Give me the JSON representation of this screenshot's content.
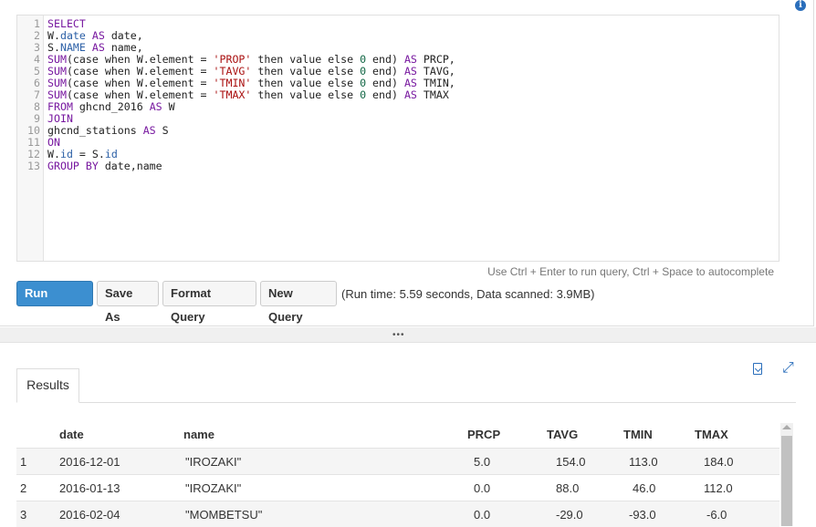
{
  "editor": {
    "lines": [
      [
        {
          "t": "SELECT",
          "c": "kw"
        }
      ],
      [
        {
          "t": "W."
        },
        {
          "t": "date",
          "c": "fld"
        },
        {
          "t": " "
        },
        {
          "t": "AS",
          "c": "kw"
        },
        {
          "t": " date,"
        }
      ],
      [
        {
          "t": "S."
        },
        {
          "t": "NAME",
          "c": "fld"
        },
        {
          "t": " "
        },
        {
          "t": "AS",
          "c": "kw"
        },
        {
          "t": " name,"
        }
      ],
      [
        {
          "t": "SUM",
          "c": "kw"
        },
        {
          "t": "(case when W.element = "
        },
        {
          "t": "'PROP'",
          "c": "str"
        },
        {
          "t": " then value else "
        },
        {
          "t": "0",
          "c": "num"
        },
        {
          "t": " end) "
        },
        {
          "t": "AS",
          "c": "kw"
        },
        {
          "t": " PRCP,"
        }
      ],
      [
        {
          "t": "SUM",
          "c": "kw"
        },
        {
          "t": "(case when W.element = "
        },
        {
          "t": "'TAVG'",
          "c": "str"
        },
        {
          "t": " then value else "
        },
        {
          "t": "0",
          "c": "num"
        },
        {
          "t": " end) "
        },
        {
          "t": "AS",
          "c": "kw"
        },
        {
          "t": " TAVG,"
        }
      ],
      [
        {
          "t": "SUM",
          "c": "kw"
        },
        {
          "t": "(case when W.element = "
        },
        {
          "t": "'TMIN'",
          "c": "str"
        },
        {
          "t": " then value else "
        },
        {
          "t": "0",
          "c": "num"
        },
        {
          "t": " end) "
        },
        {
          "t": "AS",
          "c": "kw"
        },
        {
          "t": " TMIN,"
        }
      ],
      [
        {
          "t": "SUM",
          "c": "kw"
        },
        {
          "t": "(case when W.element = "
        },
        {
          "t": "'TMAX'",
          "c": "str"
        },
        {
          "t": " then value else "
        },
        {
          "t": "0",
          "c": "num"
        },
        {
          "t": " end) "
        },
        {
          "t": "AS",
          "c": "kw"
        },
        {
          "t": " TMAX"
        }
      ],
      [
        {
          "t": "FROM",
          "c": "kw"
        },
        {
          "t": " ghcnd_2016 "
        },
        {
          "t": "AS",
          "c": "kw"
        },
        {
          "t": " W"
        }
      ],
      [
        {
          "t": "JOIN",
          "c": "kw"
        }
      ],
      [
        {
          "t": "ghcnd_stations "
        },
        {
          "t": "AS",
          "c": "kw"
        },
        {
          "t": " S"
        }
      ],
      [
        {
          "t": "ON",
          "c": "kw"
        }
      ],
      [
        {
          "t": "W."
        },
        {
          "t": "id",
          "c": "fld"
        },
        {
          "t": " = S."
        },
        {
          "t": "id",
          "c": "fld"
        }
      ],
      [
        {
          "t": "GROUP BY",
          "c": "kw"
        },
        {
          "t": " date,name"
        }
      ]
    ]
  },
  "hint": "Use Ctrl + Enter to run query, Ctrl + Space to autocomplete",
  "toolbar": {
    "run_label": "Run Query",
    "save_as_label": "Save As",
    "format_label": "Format Query",
    "new_label": "New Query",
    "status": "(Run time: 5.59 seconds, Data scanned: 3.9MB)"
  },
  "splitter_grip": "•••",
  "results": {
    "tab_label": "Results",
    "columns": [
      "",
      "date",
      "name",
      "PRCP",
      "TAVG",
      "TMIN",
      "TMAX"
    ],
    "rows": [
      [
        "1",
        "2016-12-01",
        "\"IROZAKI\"",
        "5.0",
        "154.0",
        "113.0",
        "184.0"
      ],
      [
        "2",
        "2016-01-13",
        "\"IROZAKI\"",
        "0.0",
        "88.0",
        "46.0",
        "112.0"
      ],
      [
        "3",
        "2016-02-04",
        "\"MOMBETSU\"",
        "0.0",
        "-29.0",
        "-93.0",
        "-6.0"
      ]
    ]
  },
  "icons": {
    "info": "info-icon",
    "export": "export-file-icon",
    "expand": "expand-icon"
  },
  "colors": {
    "primary_button": "#3c8fd0",
    "keyword": "#77179f",
    "string": "#aa1111",
    "icon_blue": "#2a6ebb"
  }
}
